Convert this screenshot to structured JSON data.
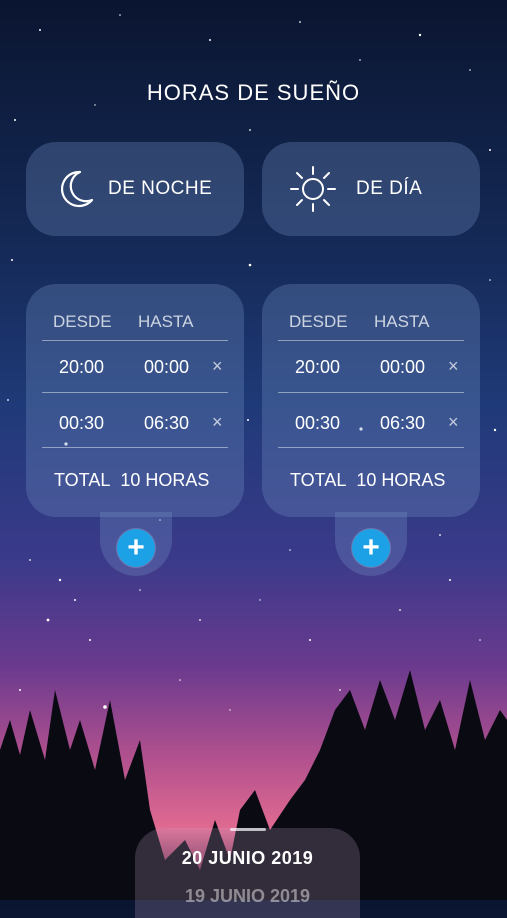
{
  "title": "HORAS DE SUEÑO",
  "modes": {
    "night": {
      "label": "DE NOCHE",
      "icon": "moon-icon"
    },
    "day": {
      "label": "DE DÍA",
      "icon": "sun-icon"
    }
  },
  "panels": {
    "left": {
      "header_from": "DESDE",
      "header_to": "HASTA",
      "rows": [
        {
          "from": "20:00",
          "to": "00:00",
          "remove": "×"
        },
        {
          "from": "00:30",
          "to": "06:30",
          "remove": "×"
        }
      ],
      "total_label": "TOTAL",
      "total_value": "10 HORAS"
    },
    "right": {
      "header_from": "DESDE",
      "header_to": "HASTA",
      "rows": [
        {
          "from": "20:00",
          "to": "00:00",
          "remove": "×"
        },
        {
          "from": "00:30",
          "to": "06:30",
          "remove": "×"
        }
      ],
      "total_label": "TOTAL",
      "total_value": "10 HORAS"
    }
  },
  "add_button": "+",
  "dates": {
    "current": "20 JUNIO 2019",
    "next": "19 JUNIO 2019"
  },
  "colors": {
    "accent": "#1da1e6"
  }
}
